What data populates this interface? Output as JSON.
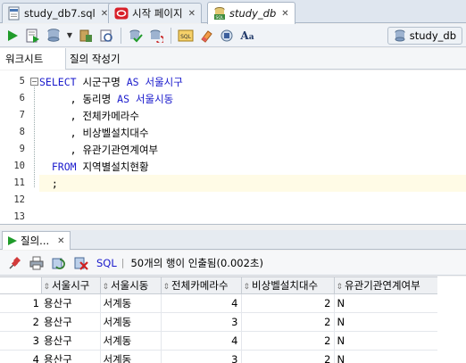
{
  "editor_tabs": [
    {
      "label": "study_db7.sql",
      "icon": "sql-file-icon",
      "active": false
    },
    {
      "label": "시작 페이지",
      "icon": "oracle-start-icon",
      "active": false
    },
    {
      "label": "study_db",
      "icon": "sql-worksheet-icon",
      "active": true
    }
  ],
  "toolbar": {
    "connection_label": "study_db"
  },
  "worksheet_tabs": [
    {
      "label": "워크시트",
      "active": true
    },
    {
      "label": "질의 작성기",
      "active": false
    }
  ],
  "editor": {
    "line_numbers": [
      "5",
      "6",
      "7",
      "8",
      "9",
      "10",
      "11",
      "12",
      "13"
    ],
    "lines": [
      [
        {
          "t": "SELECT ",
          "k": true
        },
        {
          "t": "시군구명 ",
          "k": false
        },
        {
          "t": "AS ",
          "k": true
        },
        {
          "t": "서울시구",
          "k": true
        }
      ],
      [
        {
          "t": "     , 동리명 ",
          "k": false
        },
        {
          "t": "AS ",
          "k": true
        },
        {
          "t": "서울시동",
          "k": true
        }
      ],
      [
        {
          "t": "     , 전체카메라수",
          "k": false
        }
      ],
      [
        {
          "t": "     , 비상벨설치대수",
          "k": false
        }
      ],
      [
        {
          "t": "     , 유관기관연계여부",
          "k": false
        }
      ],
      [
        {
          "t": "  FROM ",
          "k": true
        },
        {
          "t": "지역별설치현황",
          "k": false
        }
      ],
      [
        {
          "t": "  ;",
          "k": false
        }
      ],
      [],
      []
    ],
    "current_line": 6
  },
  "results": {
    "tab_label": "질의...",
    "sql_label": "SQL",
    "status": "50개의 행이 인출됨(0.002초)",
    "columns": [
      "서울시구",
      "서울시동",
      "전체카메라수",
      "비상벨설치대수",
      "유관기관연계여부"
    ],
    "rows": [
      {
        "rn": "1",
        "cells": [
          "용산구",
          "서계동",
          "4",
          "2",
          "N"
        ]
      },
      {
        "rn": "2",
        "cells": [
          "용산구",
          "서계동",
          "3",
          "2",
          "N"
        ]
      },
      {
        "rn": "3",
        "cells": [
          "용산구",
          "서계동",
          "4",
          "2",
          "N"
        ]
      },
      {
        "rn": "4",
        "cells": [
          "용산구",
          "서계동",
          "3",
          "2",
          "N"
        ]
      }
    ]
  },
  "colors": {
    "keyword": "#1a1acc",
    "current_line": "#fffbe6",
    "run_green": "#1f9b2a"
  }
}
